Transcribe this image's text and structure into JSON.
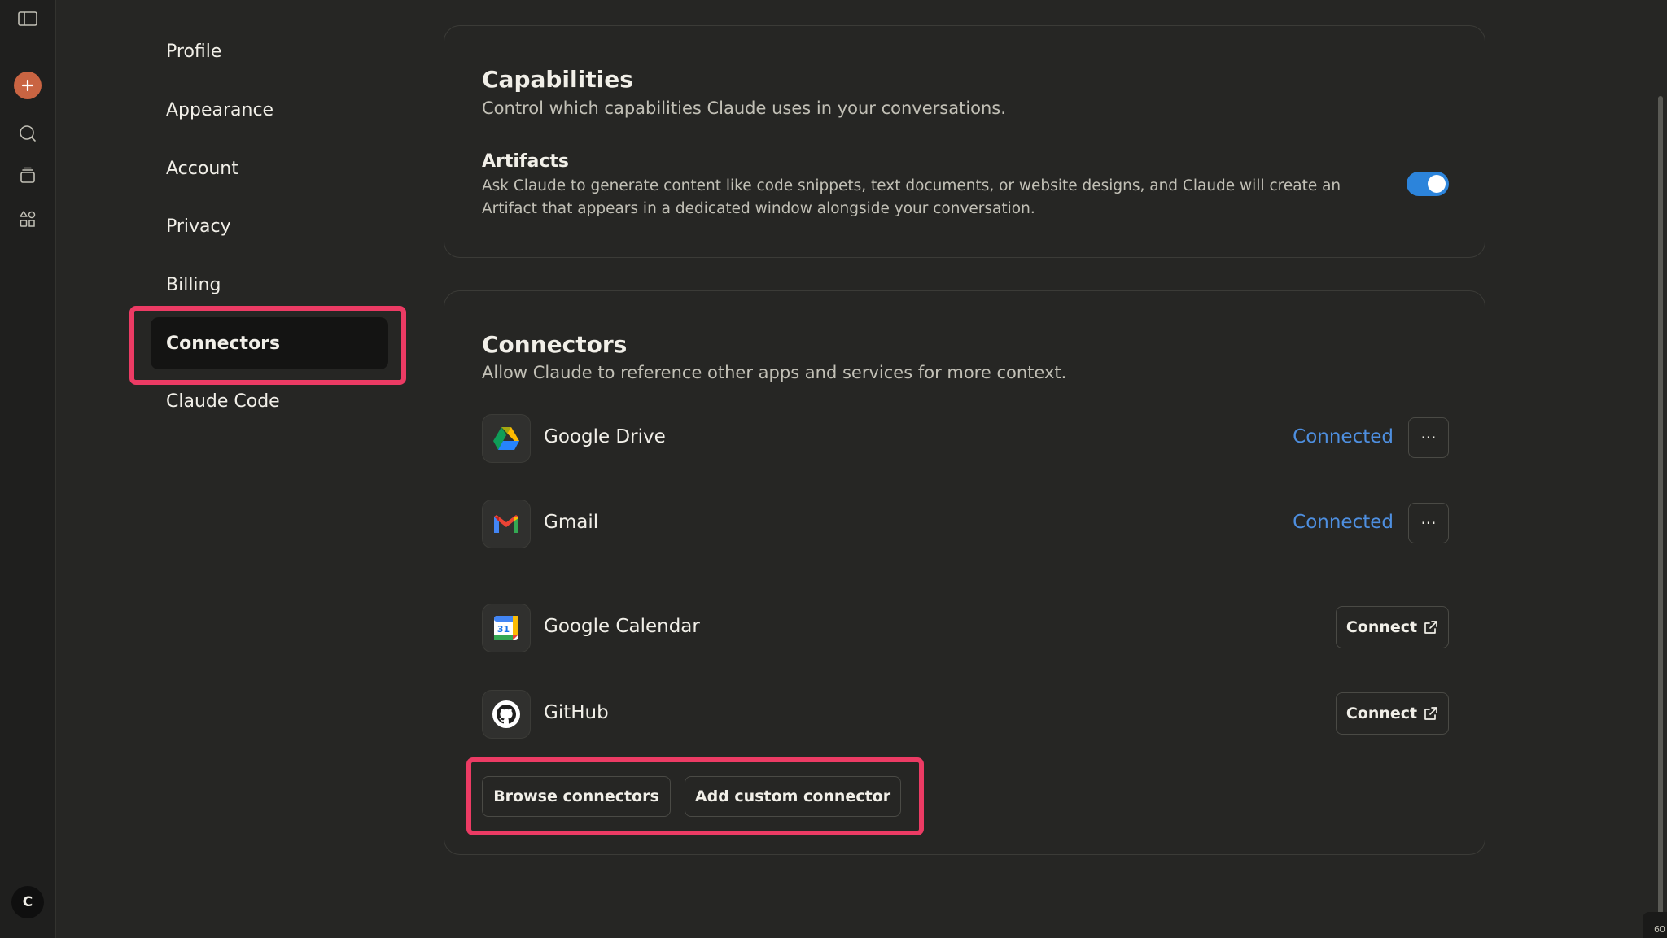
{
  "nav": {
    "items": [
      {
        "label": "Profile"
      },
      {
        "label": "Appearance"
      },
      {
        "label": "Account"
      },
      {
        "label": "Privacy"
      },
      {
        "label": "Billing"
      },
      {
        "label": "Connectors",
        "active": true
      },
      {
        "label": "Claude Code"
      }
    ]
  },
  "rail": {
    "icons": [
      "sidebar-toggle-icon",
      "new-chat-icon",
      "chats-icon",
      "projects-icon",
      "artifacts-icon"
    ],
    "avatar_initial": "C"
  },
  "capabilities": {
    "title": "Capabilities",
    "subtitle": "Control which capabilities Claude uses in your conversations.",
    "artifacts": {
      "title": "Artifacts",
      "description": "Ask Claude to generate content like code snippets, text documents, or website designs, and Claude will create an Artifact that appears in a dedicated window alongside your conversation.",
      "enabled": true
    }
  },
  "connectors": {
    "title": "Connectors",
    "subtitle": "Allow Claude to reference other apps and services for more context.",
    "items": [
      {
        "name": "Google Drive",
        "icon": "google-drive-icon",
        "status": "Connected"
      },
      {
        "name": "Gmail",
        "icon": "gmail-icon",
        "status": "Connected"
      },
      {
        "name": "Google Calendar",
        "icon": "google-calendar-icon",
        "action": "Connect",
        "calendar_day": "31"
      },
      {
        "name": "GitHub",
        "icon": "github-icon",
        "action": "Connect"
      }
    ],
    "more_label": "···",
    "browse_label": "Browse connectors",
    "add_custom_label": "Add custom connector"
  },
  "colors": {
    "accent": "#c96442",
    "link": "#4e8fe0",
    "toggle_on": "#2c84db",
    "highlight": "#ec3b64"
  },
  "corner_text": "60"
}
